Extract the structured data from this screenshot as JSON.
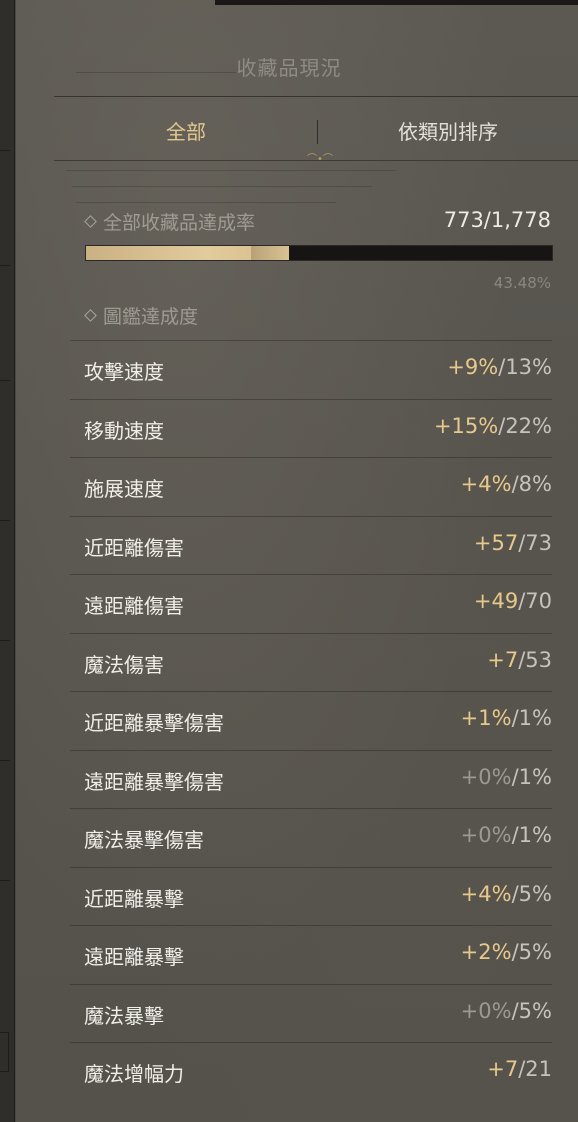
{
  "header": {
    "title": "收藏品現況"
  },
  "tabs": [
    {
      "label": "全部",
      "active": true
    },
    {
      "label": "依類別排序",
      "active": false
    }
  ],
  "collection": {
    "label": "全部收藏品達成率",
    "value": "773/1,778",
    "progress_fraction": 0.4348,
    "percent": "43.48%"
  },
  "codex": {
    "label": "圖鑑達成度",
    "rows": [
      {
        "label": "攻擊速度",
        "current": "+9%",
        "max": "13%",
        "zero": false
      },
      {
        "label": "移動速度",
        "current": "+15%",
        "max": "22%",
        "zero": false
      },
      {
        "label": "施展速度",
        "current": "+4%",
        "max": "8%",
        "zero": false
      },
      {
        "label": "近距離傷害",
        "current": "+57",
        "max": "73",
        "zero": false
      },
      {
        "label": "遠距離傷害",
        "current": "+49",
        "max": "70",
        "zero": false
      },
      {
        "label": "魔法傷害",
        "current": "+7",
        "max": "53",
        "zero": false
      },
      {
        "label": "近距離暴擊傷害",
        "current": "+1%",
        "max": "1%",
        "zero": false
      },
      {
        "label": "遠距離暴擊傷害",
        "current": "+0%",
        "max": "1%",
        "zero": true
      },
      {
        "label": "魔法暴擊傷害",
        "current": "+0%",
        "max": "1%",
        "zero": true
      },
      {
        "label": "近距離暴擊",
        "current": "+4%",
        "max": "5%",
        "zero": false
      },
      {
        "label": "遠距離暴擊",
        "current": "+2%",
        "max": "5%",
        "zero": false
      },
      {
        "label": "魔法暴擊",
        "current": "+0%",
        "max": "5%",
        "zero": true
      },
      {
        "label": "魔法增幅力",
        "current": "+7",
        "max": "21",
        "zero": false
      }
    ]
  },
  "colors": {
    "accent_gold": "#e1c88f",
    "value_gold": "#e8c98c",
    "text_light": "#f0eee9",
    "text_muted": "#9e9b93",
    "progress_bg": "#161514"
  }
}
